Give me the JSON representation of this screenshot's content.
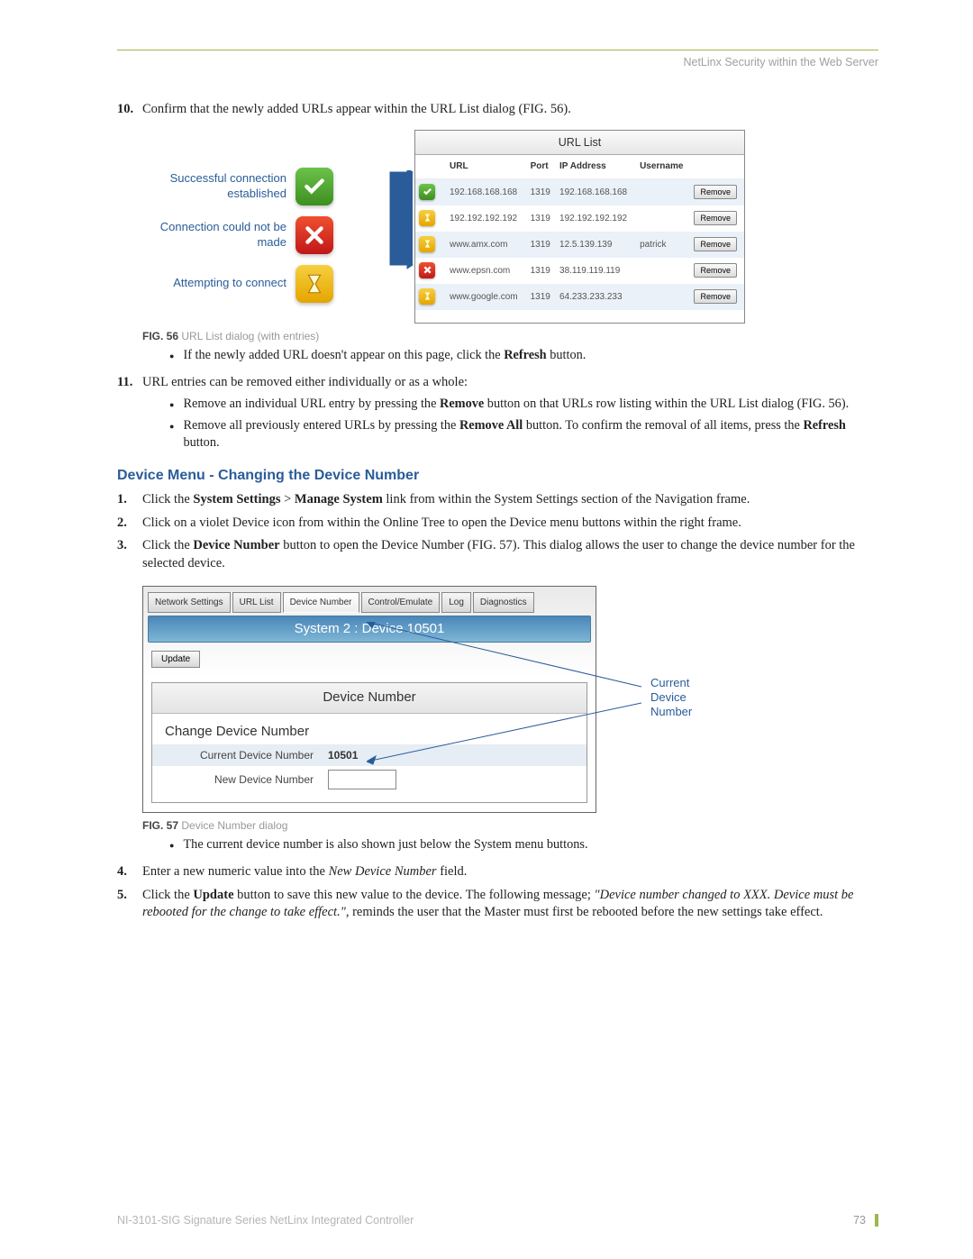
{
  "header": "NetLinx Security within the Web Server",
  "step10": "Confirm that the newly added URLs appear within the URL List dialog (FIG. 56).",
  "legend": {
    "ok": "Successful connection established",
    "fail": "Connection could not be made",
    "try": "Attempting to connect"
  },
  "urllist": {
    "title": "URL List",
    "cols": [
      "URL",
      "Port",
      "IP Address",
      "Username"
    ],
    "remove": "Remove",
    "rows": [
      {
        "icon": "ok",
        "url": "192.168.168.168",
        "port": "1319",
        "ip": "192.168.168.168",
        "user": ""
      },
      {
        "icon": "try",
        "url": "192.192.192.192",
        "port": "1319",
        "ip": "192.192.192.192",
        "user": ""
      },
      {
        "icon": "try",
        "url": "www.amx.com",
        "port": "1319",
        "ip": "12.5.139.139",
        "user": "patrick"
      },
      {
        "icon": "fail",
        "url": "www.epsn.com",
        "port": "1319",
        "ip": "38.119.119.119",
        "user": ""
      },
      {
        "icon": "try",
        "url": "www.google.com",
        "port": "1319",
        "ip": "64.233.233.233",
        "user": ""
      }
    ]
  },
  "fig56": {
    "num": "FIG. 56",
    "desc": "URL List dialog (with entries)"
  },
  "sub10_b1_a": "If the newly added URL doesn't appear on this page, click the ",
  "sub10_b1_b": "Refresh",
  "sub10_b1_c": " button.",
  "step11": "URL entries can be removed either individually or as a whole:",
  "sub11_b1_a": "Remove an individual URL entry by pressing the ",
  "sub11_b1_b": "Remove",
  "sub11_b1_c": " button on that URLs row listing within the URL List dialog (FIG. 56).",
  "sub11_b2_a": "Remove all previously entered URLs by pressing the ",
  "sub11_b2_b": "Remove All",
  "sub11_b2_c": " button. To confirm the removal of all items, press the ",
  "sub11_b2_d": "Refresh",
  "sub11_b2_e": " button.",
  "section": "Device Menu - Changing the Device Number",
  "s1_a": "Click the ",
  "s1_b": "System Settings",
  "s1_c": " > ",
  "s1_d": "Manage System",
  "s1_e": " link from within the System Settings section of the Navigation frame.",
  "s2": "Click on a violet Device icon from within the Online Tree to open the Device menu buttons within the right frame.",
  "s3_a": "Click the ",
  "s3_b": "Device Number",
  "s3_c": " button to open the Device Number (FIG. 57). This dialog allows the user to change the device number for the selected device.",
  "fig57_panel": {
    "tabs": [
      "Network Settings",
      "URL List",
      "Device Number",
      "Control/Emulate",
      "Log",
      "Diagnostics"
    ],
    "active_tab": 2,
    "sys_title": "System 2 : Device 10501",
    "update": "Update",
    "panel_hdr": "Device Number",
    "sub": "Change Device Number",
    "row1_lbl": "Current Device Number",
    "row1_val": "10501",
    "row2_lbl": "New Device Number"
  },
  "callout": "Current Device Number",
  "fig57": {
    "num": "FIG. 57",
    "desc": "Device Number dialog"
  },
  "sub3_b1": "The current device number is also shown just below the System menu buttons.",
  "s4_a": "Enter a new numeric value into the ",
  "s4_b": "New Device Number",
  "s4_c": " field.",
  "s5_a": "Click the ",
  "s5_b": "Update",
  "s5_c": " button to save this new value to the device. The following message; ",
  "s5_d": "\"Device number changed to XXX. Device must be rebooted for the change to take effect.\"",
  "s5_e": ", reminds the user that the Master must first be rebooted before the new settings take effect.",
  "footer_left": "NI-3101-SIG Signature Series NetLinx Integrated Controller",
  "footer_page": "73"
}
